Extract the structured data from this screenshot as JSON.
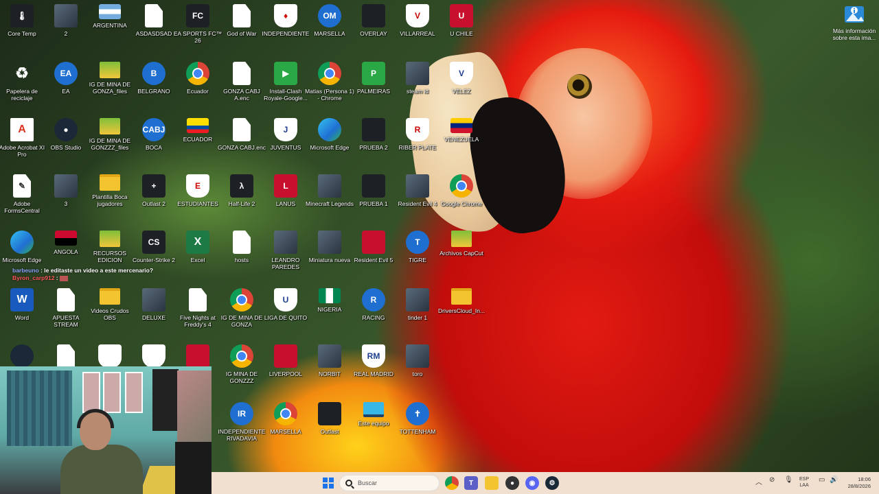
{
  "desktop_icons": [
    {
      "label": "Core Temp",
      "glyph": "🌡",
      "kind": "g-dark"
    },
    {
      "label": "2",
      "glyph": "",
      "kind": "g-photo"
    },
    {
      "label": "ARGENTINA",
      "glyph": "",
      "kind": "g-flag-ar"
    },
    {
      "label": "ASDASDSAD",
      "glyph": "",
      "kind": "g-doc"
    },
    {
      "label": "EA SPORTS FC™ 26",
      "glyph": "FC",
      "kind": "g-dark"
    },
    {
      "label": "God of War",
      "glyph": "",
      "kind": "g-doc"
    },
    {
      "label": "INDEPENDIENTE",
      "glyph": "♦",
      "kind": "g-crest"
    },
    {
      "label": "MARSELLA",
      "glyph": "OM",
      "kind": "g-blue"
    },
    {
      "label": "OVERLAY",
      "glyph": "",
      "kind": "g-dark"
    },
    {
      "label": "VILLARREAL",
      "glyph": "V",
      "kind": "g-crest"
    },
    {
      "label": "U CHILE",
      "glyph": "U",
      "kind": "g-red"
    },
    {
      "label": "Papelera de reciclaje",
      "glyph": "♻",
      "kind": "g-recycle"
    },
    {
      "label": "EA",
      "glyph": "EA",
      "kind": "g-blue"
    },
    {
      "label": "IG DE MINA DE GONZA_files",
      "glyph": "",
      "kind": "g-folder-green"
    },
    {
      "label": "BELGRANO",
      "glyph": "B",
      "kind": "g-blue"
    },
    {
      "label": "Ecuador",
      "glyph": "",
      "kind": "g-chrome"
    },
    {
      "label": "GONZA CABJ A.enc",
      "glyph": "",
      "kind": "g-doc"
    },
    {
      "label": "Install-Clash Royale-Google...",
      "glyph": "▶",
      "kind": "g-green"
    },
    {
      "label": "Matias (Persona 1) - Chrome",
      "glyph": "",
      "kind": "g-chrome"
    },
    {
      "label": "PALMEIRAS",
      "glyph": "P",
      "kind": "g-green"
    },
    {
      "label": "steam id",
      "glyph": "",
      "kind": "g-photo"
    },
    {
      "label": "VELEZ",
      "glyph": "V",
      "kind": "g-white-shield"
    },
    {
      "label": "Adobe Acrobat XI Pro",
      "glyph": "A",
      "kind": "g-pdf"
    },
    {
      "label": "OBS Studio",
      "glyph": "●",
      "kind": "g-steam"
    },
    {
      "label": "IG DE MINA DE GONZZZ_files",
      "glyph": "",
      "kind": "g-folder-green"
    },
    {
      "label": "BOCA",
      "glyph": "CABJ",
      "kind": "g-blue"
    },
    {
      "label": "ECUADOR",
      "glyph": "",
      "kind": "g-flag-ec"
    },
    {
      "label": "GONZA CABJ.enc",
      "glyph": "",
      "kind": "g-doc"
    },
    {
      "label": "JUVENTUS",
      "glyph": "J",
      "kind": "g-white-shield"
    },
    {
      "label": "Microsoft Edge",
      "glyph": "",
      "kind": "g-edge"
    },
    {
      "label": "PRUEBA 2",
      "glyph": "",
      "kind": "g-dark"
    },
    {
      "label": "RIBER PLATE",
      "glyph": "R",
      "kind": "g-crest"
    },
    {
      "label": "VENEZUELA",
      "glyph": "",
      "kind": "g-flag-ve"
    },
    {
      "label": "Adobe FormsCentral",
      "glyph": "✎",
      "kind": "g-doc"
    },
    {
      "label": "3",
      "glyph": "",
      "kind": "g-photo"
    },
    {
      "label": "Plantilla Boca jugadores",
      "glyph": "",
      "kind": "g-folder"
    },
    {
      "label": "Outlast 2",
      "glyph": "+",
      "kind": "g-dark"
    },
    {
      "label": "ESTUDIANTES",
      "glyph": "E",
      "kind": "g-crest"
    },
    {
      "label": "Half-Life 2",
      "glyph": "λ",
      "kind": "g-dark"
    },
    {
      "label": "LANUS",
      "glyph": "L",
      "kind": "g-red"
    },
    {
      "label": "Minecraft Legends",
      "glyph": "",
      "kind": "g-photo"
    },
    {
      "label": "PRUEBA 1",
      "glyph": "",
      "kind": "g-dark"
    },
    {
      "label": "Resident Evil 4",
      "glyph": "",
      "kind": "g-photo"
    },
    {
      "label": "Google Chrome",
      "glyph": "",
      "kind": "g-chrome"
    },
    {
      "label": "Microsoft Edge",
      "glyph": "",
      "kind": "g-edge"
    },
    {
      "label": "ANGOLA",
      "glyph": "",
      "kind": "g-flag-ao"
    },
    {
      "label": "RECURSOS EDICION",
      "glyph": "",
      "kind": "g-folder-green"
    },
    {
      "label": "Counter-Strike 2",
      "glyph": "CS",
      "kind": "g-dark"
    },
    {
      "label": "Excel",
      "glyph": "X",
      "kind": "g-excel"
    },
    {
      "label": "hosts",
      "glyph": "",
      "kind": "g-doc"
    },
    {
      "label": "LEANDRO PAREDES",
      "glyph": "",
      "kind": "g-photo"
    },
    {
      "label": "Miniatura nueva",
      "glyph": "",
      "kind": "g-photo"
    },
    {
      "label": "Resident Evil 5",
      "glyph": "",
      "kind": "g-red"
    },
    {
      "label": "TIGRE",
      "glyph": "T",
      "kind": "g-blue"
    },
    {
      "label": "Archivos CapCut",
      "glyph": "",
      "kind": "g-folder-green"
    },
    {
      "label": "Word",
      "glyph": "W",
      "kind": "g-word"
    },
    {
      "label": "APUESTA STREAM",
      "glyph": "",
      "kind": "g-doc"
    },
    {
      "label": "Videos Crudos OBS",
      "glyph": "",
      "kind": "g-folder"
    },
    {
      "label": "DELUXE",
      "glyph": "",
      "kind": "g-photo"
    },
    {
      "label": "Five Nights at Freddy's 4",
      "glyph": "",
      "kind": "g-doc"
    },
    {
      "label": "IG DE MINA DE GONZA",
      "glyph": "",
      "kind": "g-chrome"
    },
    {
      "label": "LIGA DE QUITO",
      "glyph": "U",
      "kind": "g-white-shield"
    },
    {
      "label": "NIGERIA",
      "glyph": "",
      "kind": "g-flag-ng"
    },
    {
      "label": "RACING",
      "glyph": "R",
      "kind": "g-blue"
    },
    {
      "label": "tinder 1",
      "glyph": "",
      "kind": "g-photo"
    },
    {
      "label": "DriversCloud_In...",
      "glyph": "",
      "kind": "g-folder"
    },
    {
      "label": "",
      "glyph": "",
      "kind": "g-steam"
    },
    {
      "label": "",
      "glyph": "",
      "kind": "g-doc"
    },
    {
      "label": "",
      "glyph": "",
      "kind": "g-crest"
    },
    {
      "label": "",
      "glyph": "",
      "kind": "g-white-shield"
    },
    {
      "label": "",
      "glyph": "",
      "kind": "g-red"
    },
    {
      "label": "IG MINA DE GONZZZ",
      "glyph": "",
      "kind": "g-chrome"
    },
    {
      "label": "LIVERPOOL",
      "glyph": "",
      "kind": "g-red"
    },
    {
      "label": "NORBIT",
      "glyph": "",
      "kind": "g-photo"
    },
    {
      "label": "REAL MADRID",
      "glyph": "RM",
      "kind": "g-white-shield"
    },
    {
      "label": "toro",
      "glyph": "",
      "kind": "g-photo"
    },
    {
      "label": "INDEPENDIENTE RIVADAVIA",
      "glyph": "IR",
      "kind": "g-blue"
    },
    {
      "label": "MARSELLA",
      "glyph": "",
      "kind": "g-chrome"
    },
    {
      "label": "Outlast",
      "glyph": "",
      "kind": "g-dark"
    },
    {
      "label": "Este equipo",
      "glyph": "",
      "kind": "g-monitor"
    },
    {
      "label": "TOTTENHAM",
      "glyph": "✝",
      "kind": "g-blue"
    }
  ],
  "chat": {
    "line1_user": "barbeuno",
    "line1_msg": " : le editaste un video a este mercenario?",
    "line2_user": "Byron_carp912",
    "line2_msg": " : "
  },
  "info_widget": {
    "label": "Más información sobre esta ima..."
  },
  "taskbar": {
    "search_placeholder": "Buscar",
    "lang_top": "ESP",
    "lang_bottom": "LAA",
    "time": "18:06",
    "date": "28/8/2026"
  }
}
